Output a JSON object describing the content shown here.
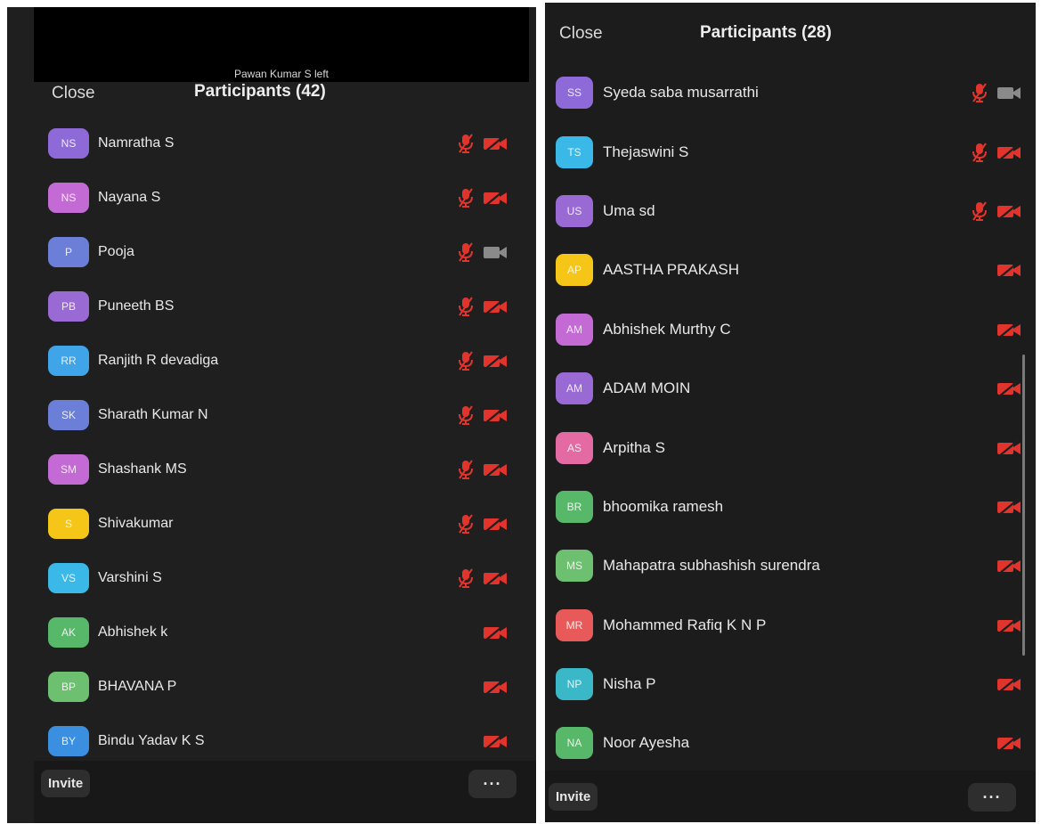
{
  "left": {
    "banner_text": "Pawan Kumar S left",
    "close_label": "Close",
    "title": "Participants (42)",
    "participants": [
      {
        "initials": "NS",
        "name": "Namratha S",
        "color": "#8e6ad8",
        "mic": "muted",
        "video": "off"
      },
      {
        "initials": "NS",
        "name": "Nayana S",
        "color": "#c46ad4",
        "mic": "muted",
        "video": "off"
      },
      {
        "initials": "P",
        "name": "Pooja",
        "color": "#6b7fd8",
        "mic": "muted",
        "video": "on"
      },
      {
        "initials": "PB",
        "name": "Puneeth BS",
        "color": "#9a6ad4",
        "mic": "muted",
        "video": "off"
      },
      {
        "initials": "RR",
        "name": "Ranjith R devadiga",
        "color": "#3fa4e8",
        "mic": "muted",
        "video": "off"
      },
      {
        "initials": "SK",
        "name": "Sharath Kumar N",
        "color": "#6b7fd8",
        "mic": "muted",
        "video": "off"
      },
      {
        "initials": "SM",
        "name": "Shashank MS",
        "color": "#c46ad4",
        "mic": "muted",
        "video": "off"
      },
      {
        "initials": "S",
        "name": "Shivakumar",
        "color": "#f5c518",
        "mic": "muted",
        "video": "off"
      },
      {
        "initials": "VS",
        "name": "Varshini S",
        "color": "#3ab8e8",
        "mic": "muted",
        "video": "off"
      },
      {
        "initials": "AK",
        "name": "Abhishek k",
        "color": "#58b86a",
        "mic": "none",
        "video": "off"
      },
      {
        "initials": "BP",
        "name": "BHAVANA P",
        "color": "#6cc06f",
        "mic": "none",
        "video": "off"
      },
      {
        "initials": "BY",
        "name": "Bindu Yadav K S",
        "color": "#3a8fe0",
        "mic": "none",
        "video": "off"
      }
    ],
    "invite_label": "Invite",
    "more_label": "···"
  },
  "right": {
    "close_label": "Close",
    "title": "Participants (28)",
    "participants": [
      {
        "initials": "SS",
        "name": "Syeda saba musarrathi",
        "color": "#8e6ad8",
        "mic": "muted",
        "video": "on"
      },
      {
        "initials": "TS",
        "name": "Thejaswini S",
        "color": "#3ab8e8",
        "mic": "muted",
        "video": "off"
      },
      {
        "initials": "US",
        "name": "Uma sd",
        "color": "#9a6ad4",
        "mic": "muted",
        "video": "off"
      },
      {
        "initials": "AP",
        "name": "AASTHA PRAKASH",
        "color": "#f5c518",
        "mic": "none",
        "video": "off"
      },
      {
        "initials": "AM",
        "name": "Abhishek Murthy C",
        "color": "#c46ad4",
        "mic": "none",
        "video": "off"
      },
      {
        "initials": "AM",
        "name": "ADAM MOIN",
        "color": "#9a6ad4",
        "mic": "none",
        "video": "off"
      },
      {
        "initials": "AS",
        "name": "Arpitha S",
        "color": "#e46aa4",
        "mic": "none",
        "video": "off"
      },
      {
        "initials": "BR",
        "name": "bhoomika ramesh",
        "color": "#58b86a",
        "mic": "none",
        "video": "off"
      },
      {
        "initials": "MS",
        "name": "Mahapatra subhashish surendra",
        "color": "#6cc06f",
        "mic": "none",
        "video": "off"
      },
      {
        "initials": "MR",
        "name": "Mohammed Rafiq K N P",
        "color": "#e85a5a",
        "mic": "none",
        "video": "off"
      },
      {
        "initials": "NP",
        "name": "Nisha P",
        "color": "#3ab8c8",
        "mic": "none",
        "video": "off"
      },
      {
        "initials": "NA",
        "name": "Noor Ayesha",
        "color": "#58b86a",
        "mic": "none",
        "video": "off"
      }
    ],
    "invite_label": "Invite",
    "more_label": "···"
  },
  "icons": {
    "muted_mic": "mic-muted-icon",
    "video_off": "video-off-icon",
    "video_on": "video-on-icon"
  },
  "colors": {
    "muted_red": "#e0342d",
    "video_on_gray": "#8a8a8a",
    "panel_bg": "#1f1f1f"
  }
}
